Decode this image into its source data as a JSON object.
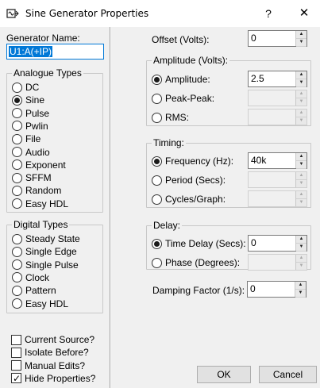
{
  "window": {
    "title": "Sine Generator Properties",
    "help_glyph": "?",
    "close_glyph": "✕"
  },
  "left": {
    "generator_name_label": "Generator Name:",
    "generator_name_value": "U1:A(+IP)",
    "analogue_title": "Analogue Types",
    "analogue_types": [
      "DC",
      "Sine",
      "Pulse",
      "Pwlin",
      "File",
      "Audio",
      "Exponent",
      "SFFM",
      "Random",
      "Easy HDL"
    ],
    "analogue_selected": "Sine",
    "digital_title": "Digital Types",
    "digital_types": [
      "Steady State",
      "Single Edge",
      "Single Pulse",
      "Clock",
      "Pattern",
      "Easy HDL"
    ],
    "options": [
      {
        "label": "Current Source?",
        "checked": false
      },
      {
        "label": "Isolate Before?",
        "checked": false
      },
      {
        "label": "Manual Edits?",
        "checked": false
      },
      {
        "label": "Hide Properties?",
        "checked": true
      }
    ]
  },
  "right": {
    "offset_label": "Offset (Volts):",
    "offset_value": "0",
    "amplitude_title": "Amplitude (Volts):",
    "amplitude_opts": [
      "Amplitude:",
      "Peak-Peak:",
      "RMS:"
    ],
    "amplitude_value": "2.5",
    "timing_title": "Timing:",
    "timing_opts": [
      "Frequency (Hz):",
      "Period (Secs):",
      "Cycles/Graph:"
    ],
    "frequency_value": "40k",
    "delay_title": "Delay:",
    "delay_opts": [
      "Time Delay (Secs):",
      "Phase (Degrees):"
    ],
    "delay_value": "0",
    "damping_label": "Damping Factor (1/s):",
    "damping_value": "0",
    "ok_label": "OK",
    "cancel_label": "Cancel"
  }
}
